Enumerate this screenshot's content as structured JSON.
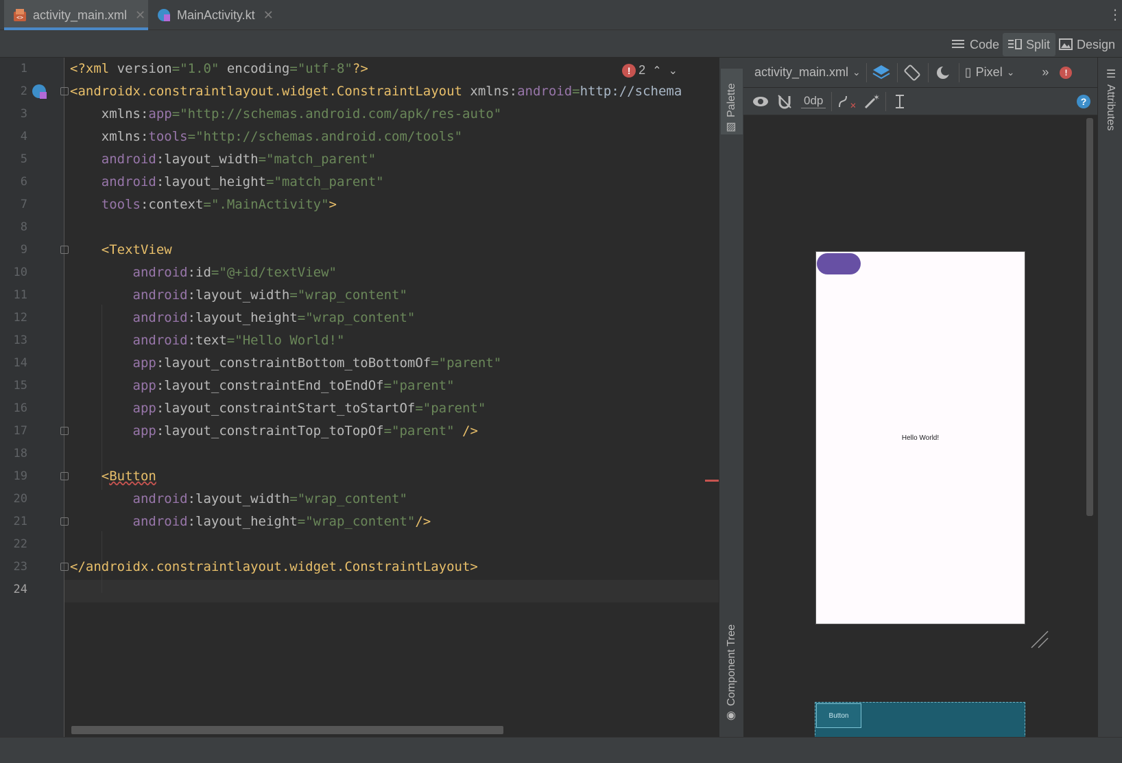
{
  "tabs": [
    {
      "label": "activity_main.xml",
      "icon": "xml-file-icon",
      "active": true
    },
    {
      "label": "MainActivity.kt",
      "icon": "kotlin-file-icon",
      "active": false
    }
  ],
  "view_modes": {
    "code": "Code",
    "split": "Split",
    "design": "Design",
    "selected": "Split"
  },
  "editor": {
    "error_count": "2",
    "current_line": 24,
    "line_numbers": [
      "1",
      "2",
      "3",
      "4",
      "5",
      "6",
      "7",
      "8",
      "9",
      "10",
      "11",
      "12",
      "13",
      "14",
      "15",
      "16",
      "17",
      "18",
      "19",
      "20",
      "21",
      "22",
      "23",
      "24"
    ],
    "lines": [
      "<?xml version=\"1.0\" encoding=\"utf-8\"?>",
      "<androidx.constraintlayout.widget.ConstraintLayout xmlns:android=\"http://schema",
      "    xmlns:app=\"http://schemas.android.com/apk/res-auto\"",
      "    xmlns:tools=\"http://schemas.android.com/tools\"",
      "    android:layout_width=\"match_parent\"",
      "    android:layout_height=\"match_parent\"",
      "    tools:context=\".MainActivity\">",
      "",
      "    <TextView",
      "        android:id=\"@+id/textView\"",
      "        android:layout_width=\"wrap_content\"",
      "        android:layout_height=\"wrap_content\"",
      "        android:text=\"Hello World!\"",
      "        app:layout_constraintBottom_toBottomOf=\"parent\"",
      "        app:layout_constraintEnd_toEndOf=\"parent\"",
      "        app:layout_constraintStart_toStartOf=\"parent\"",
      "        app:layout_constraintTop_toTopOf=\"parent\" />",
      "",
      "    <Button",
      "        android:layout_width=\"wrap_content\"",
      "        android:layout_height=\"wrap_content\"/>",
      "",
      "</androidx.constraintlayout.widget.ConstraintLayout>",
      ""
    ]
  },
  "side_panels": {
    "palette": "Palette",
    "component_tree": "Component Tree",
    "attributes": "Attributes"
  },
  "design_toolbar": {
    "file": "activity_main.xml",
    "device": "Pixel",
    "margin": "0dp"
  },
  "preview": {
    "hello_text": "Hello World!",
    "blueprint_button_label": "Button",
    "colors": {
      "button": "#6750a4",
      "blueprint": "#1d5c6e",
      "screen": "#fffbfe"
    }
  },
  "colors": {
    "accent": "#4a88c7",
    "error": "#c75450",
    "background": "#2b2b2b",
    "toolbar": "#3c3f41"
  }
}
